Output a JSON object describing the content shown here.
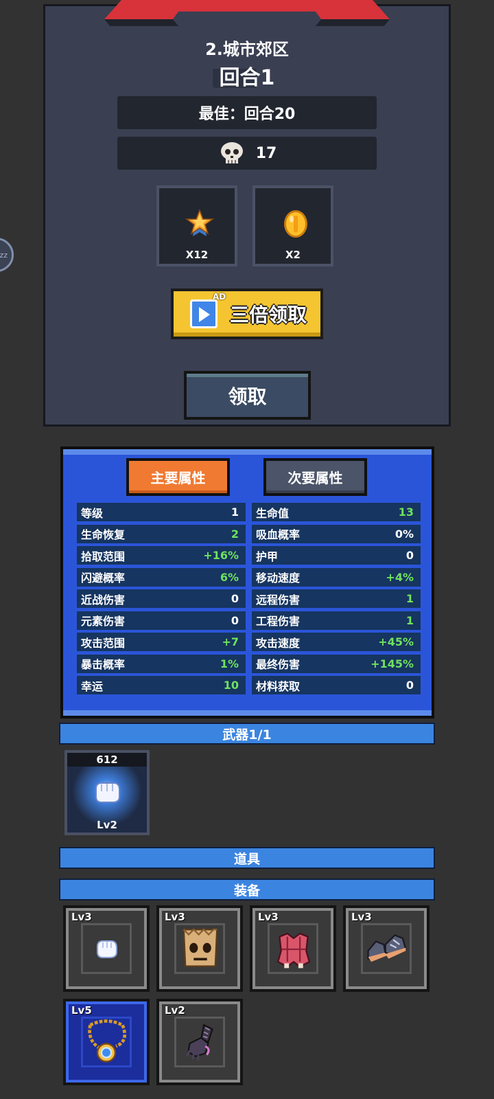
{
  "result": {
    "stage_name": "2.城市郊区",
    "round_label": "回合1",
    "best_label": "最佳：回合20",
    "kills": "17",
    "rewards": [
      {
        "icon": "star-medal-icon",
        "qty": "X12"
      },
      {
        "icon": "gold-coin-icon",
        "qty": "X2"
      }
    ],
    "triple_claim": {
      "ad_tag": "AD",
      "label": "三倍领取"
    },
    "claim_label": "领取"
  },
  "side_bubble": "zz",
  "stats": {
    "tabs": {
      "primary": "主要属性",
      "secondary": "次要属性"
    },
    "left": [
      {
        "name": "等级",
        "value": "1",
        "green": false
      },
      {
        "name": "生命恢复",
        "value": "2",
        "green": true
      },
      {
        "name": "拾取范围",
        "value": "+16%",
        "green": true
      },
      {
        "name": "闪避概率",
        "value": "6%",
        "green": true
      },
      {
        "name": "近战伤害",
        "value": "0",
        "green": false
      },
      {
        "name": "元素伤害",
        "value": "0",
        "green": false
      },
      {
        "name": "攻击范围",
        "value": "+7",
        "green": true
      },
      {
        "name": "暴击概率",
        "value": "1%",
        "green": true
      },
      {
        "name": "幸运",
        "value": "10",
        "green": true
      }
    ],
    "right": [
      {
        "name": "生命值",
        "value": "13",
        "green": true
      },
      {
        "name": "吸血概率",
        "value": "0%",
        "green": false
      },
      {
        "name": "护甲",
        "value": "0",
        "green": false
      },
      {
        "name": "移动速度",
        "value": "+4%",
        "green": true
      },
      {
        "name": "远程伤害",
        "value": "1",
        "green": true
      },
      {
        "name": "工程伤害",
        "value": "1",
        "green": true
      },
      {
        "name": "攻击速度",
        "value": "+45%",
        "green": true
      },
      {
        "name": "最终伤害",
        "value": "+145%",
        "green": true
      },
      {
        "name": "材料获取",
        "value": "0",
        "green": false
      }
    ]
  },
  "weapons": {
    "header": "武器1/1",
    "items": [
      {
        "count": "612",
        "level": "Lv2",
        "icon": "fist-icon"
      }
    ]
  },
  "items_header": "道具",
  "equipment": {
    "header": "装备",
    "items": [
      {
        "level": "Lv3",
        "icon": "white-glove-icon"
      },
      {
        "level": "Lv3",
        "icon": "paper-bag-mask-icon"
      },
      {
        "level": "Lv3",
        "icon": "red-armor-icon"
      },
      {
        "level": "Lv3",
        "icon": "sneakers-icon"
      },
      {
        "level": "Lv5",
        "icon": "amulet-icon"
      },
      {
        "level": "Lv2",
        "icon": "dark-gauntlet-icon"
      }
    ]
  }
}
